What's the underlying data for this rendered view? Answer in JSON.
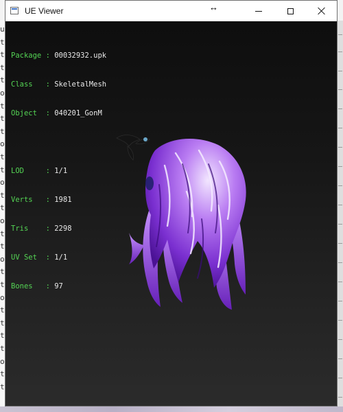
{
  "window": {
    "title": "UE Viewer",
    "icons": {
      "app": "app-window-icon",
      "resize": "horizontal-resize-cursor-icon",
      "minimize": "minimize-icon",
      "maximize": "maximize-icon",
      "close": "close-icon"
    }
  },
  "info_panel": {
    "general": [
      {
        "key": "Package",
        "sep": " : ",
        "value": "00032932.upk"
      },
      {
        "key": "Class  ",
        "sep": " : ",
        "value": "SkeletalMesh"
      },
      {
        "key": "Object ",
        "sep": " : ",
        "value": "040201_GonM"
      }
    ],
    "mesh": [
      {
        "key": "LOD    ",
        "sep": " : ",
        "value": "1/1"
      },
      {
        "key": "Verts  ",
        "sep": " : ",
        "value": "1981"
      },
      {
        "key": "Tris   ",
        "sep": " : ",
        "value": "2298"
      },
      {
        "key": "UV Set ",
        "sep": " : ",
        "value": "1/1"
      },
      {
        "key": "Bones  ",
        "sep": " : ",
        "value": "97"
      }
    ],
    "colors": {
      "key": "#54d454",
      "value": "#e8e8e8"
    }
  },
  "background_terminal": {
    "glyphs": [
      "u",
      "t",
      "t",
      "t",
      "t",
      "o",
      "t",
      "t",
      "t",
      "o",
      "t",
      "t",
      "o",
      "t",
      "t",
      "o",
      "t",
      "t",
      "o",
      "t",
      "t",
      "o",
      "t",
      "t",
      "t",
      "t",
      "o",
      "t",
      "t"
    ]
  },
  "viewport": {
    "model_name": "purple-hair-skeletal-mesh",
    "colors": {
      "hair_light": "#e6d2ff",
      "hair_mid": "#a154ea",
      "hair_dark": "#5a17a8",
      "ornament": "#141414"
    }
  }
}
